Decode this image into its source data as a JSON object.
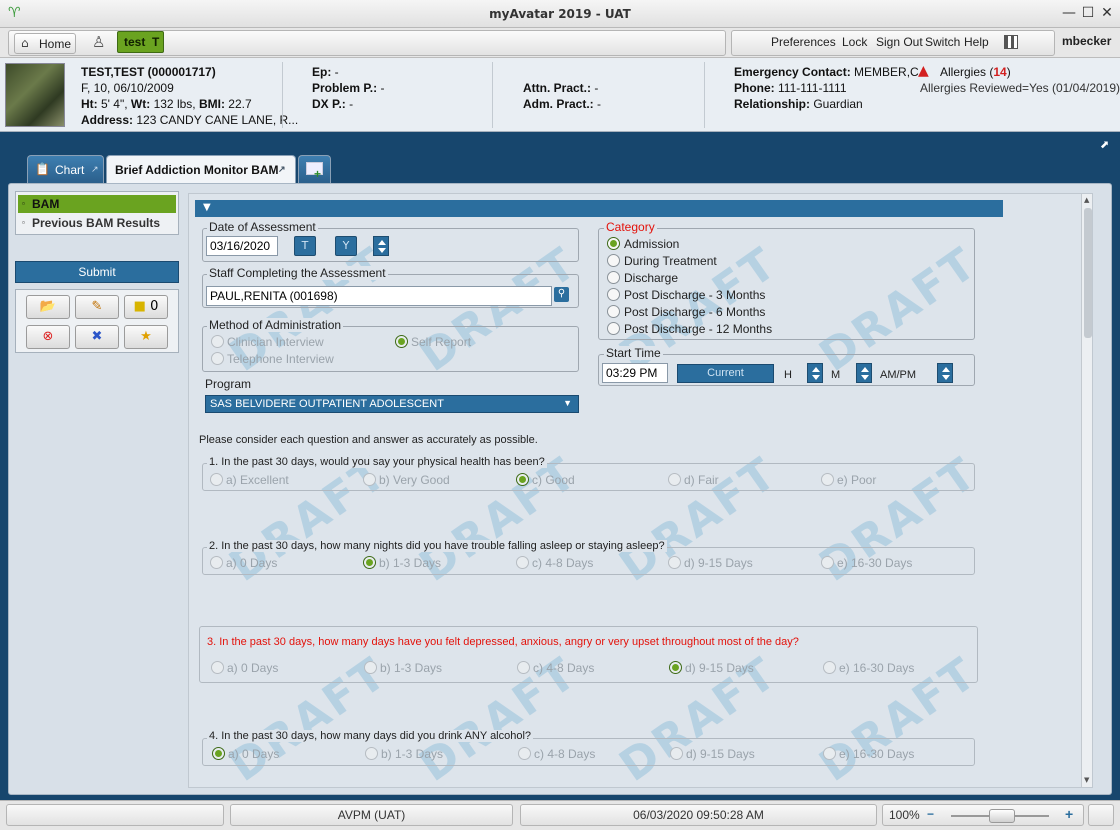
{
  "window": {
    "title": "myAvatar 2019 - UAT"
  },
  "toolbar": {
    "home_label": "Home",
    "client_tab_label": "test  T",
    "links": [
      "Preferences",
      "Lock",
      "Sign Out",
      "Switch",
      "Help"
    ],
    "user": "mbecker"
  },
  "patient": {
    "name": "TEST,TEST (000001717)",
    "demographics": "F, 10, 06/10/2009",
    "ht_label": "Ht:",
    "ht": " 5' 4\",",
    "wt_label": "Wt:",
    "wt": " 132 lbs,",
    "bmi_label": "BMI:",
    "bmi": " 22.7",
    "address_label": "Address:",
    "address": " 123 CANDY CANE LANE, R...",
    "ep_label": "Ep:",
    "ep": " -",
    "problem_label": "Problem P.:",
    "problem": " -",
    "dx_label": "DX P.:",
    "dx": " -",
    "attn_label": "Attn. Pract.:",
    "attn": " -",
    "adm_label": "Adm. Pract.:",
    "adm": " -",
    "emergency_label": "Emergency Contact:",
    "emergency": " MEMBER,C...",
    "phone_label": "Phone:",
    "phone": " 111-111-1111",
    "relationship_label": "Relationship:",
    "relationship": " Guardian",
    "allergies_label": "Allergies (",
    "allergies_count": "14",
    "allergies_close": ")",
    "allergies_reviewed": "Allergies Reviewed=Yes (01/04/2019)"
  },
  "tabs": {
    "chart": "Chart",
    "bam": "Brief Addiction Monitor BAM"
  },
  "nav": {
    "items": [
      "BAM",
      "Previous BAM Results"
    ],
    "submit": "Submit",
    "sticky_count": "0"
  },
  "form": {
    "date_legend": "Date of Assessment",
    "date_value": "03/16/2020",
    "t_btn": "T",
    "y_btn": "Y",
    "staff_legend": "Staff Completing the Assessment",
    "staff_value": "PAUL,RENITA (001698)",
    "method_legend": "Method of Administration",
    "method_options": [
      "Clinician Interview",
      "Self Report",
      "Telephone Interview"
    ],
    "program_label": "Program",
    "program_value": "SAS BELVIDERE OUTPATIENT ADOLESCENT",
    "category_legend": "Category",
    "category_options": [
      "Admission",
      "During Treatment",
      "Discharge",
      "Post Discharge - 3 Months",
      "Post Discharge - 6 Months",
      "Post Discharge - 12 Months"
    ],
    "start_legend": "Start Time",
    "start_value": "03:29 PM",
    "current_btn": "Current",
    "h_label": "H",
    "m_label": "M",
    "ampm_label": "AM/PM",
    "instructions": "Please consider each question and answer as accurately as possible.",
    "questions": [
      {
        "text": "1.  In the past 30 days, would you say your physical health has been?",
        "options": [
          "a) Excellent",
          "b) Very Good",
          "c) Good",
          "d) Fair",
          "e) Poor"
        ]
      },
      {
        "text": "2.  In the past 30 days, how many nights did you have trouble falling asleep or staying asleep?",
        "options": [
          "a) 0 Days",
          "b) 1-3 Days",
          "c) 4-8 Days",
          "d) 9-15 Days",
          "e) 16-30 Days"
        ]
      },
      {
        "text": "3. In the past 30 days, how many days have you felt depressed, anxious, angry or very upset throughout most of the day?",
        "options": [
          "a) 0 Days",
          "b) 1-3 Days",
          "c) 4-8 Days",
          "d) 9-15 Days",
          "e) 16-30 Days"
        ]
      },
      {
        "text": "4.  In the past 30 days, how many days did you drink ANY alcohol?",
        "options": [
          "a) 0 Days",
          "b) 1-3 Days",
          "c) 4-8 Days",
          "d) 9-15 Days",
          "e) 16-30 Days"
        ]
      }
    ],
    "watermark": "DRAFT"
  },
  "status": {
    "system": "AVPM (UAT)",
    "datetime": "06/03/2020 09:50:28 AM",
    "zoom": "100%"
  },
  "colors": {
    "accent_green": "#6aa320",
    "band_blue": "#17466d",
    "required_red": "#e3120b"
  }
}
